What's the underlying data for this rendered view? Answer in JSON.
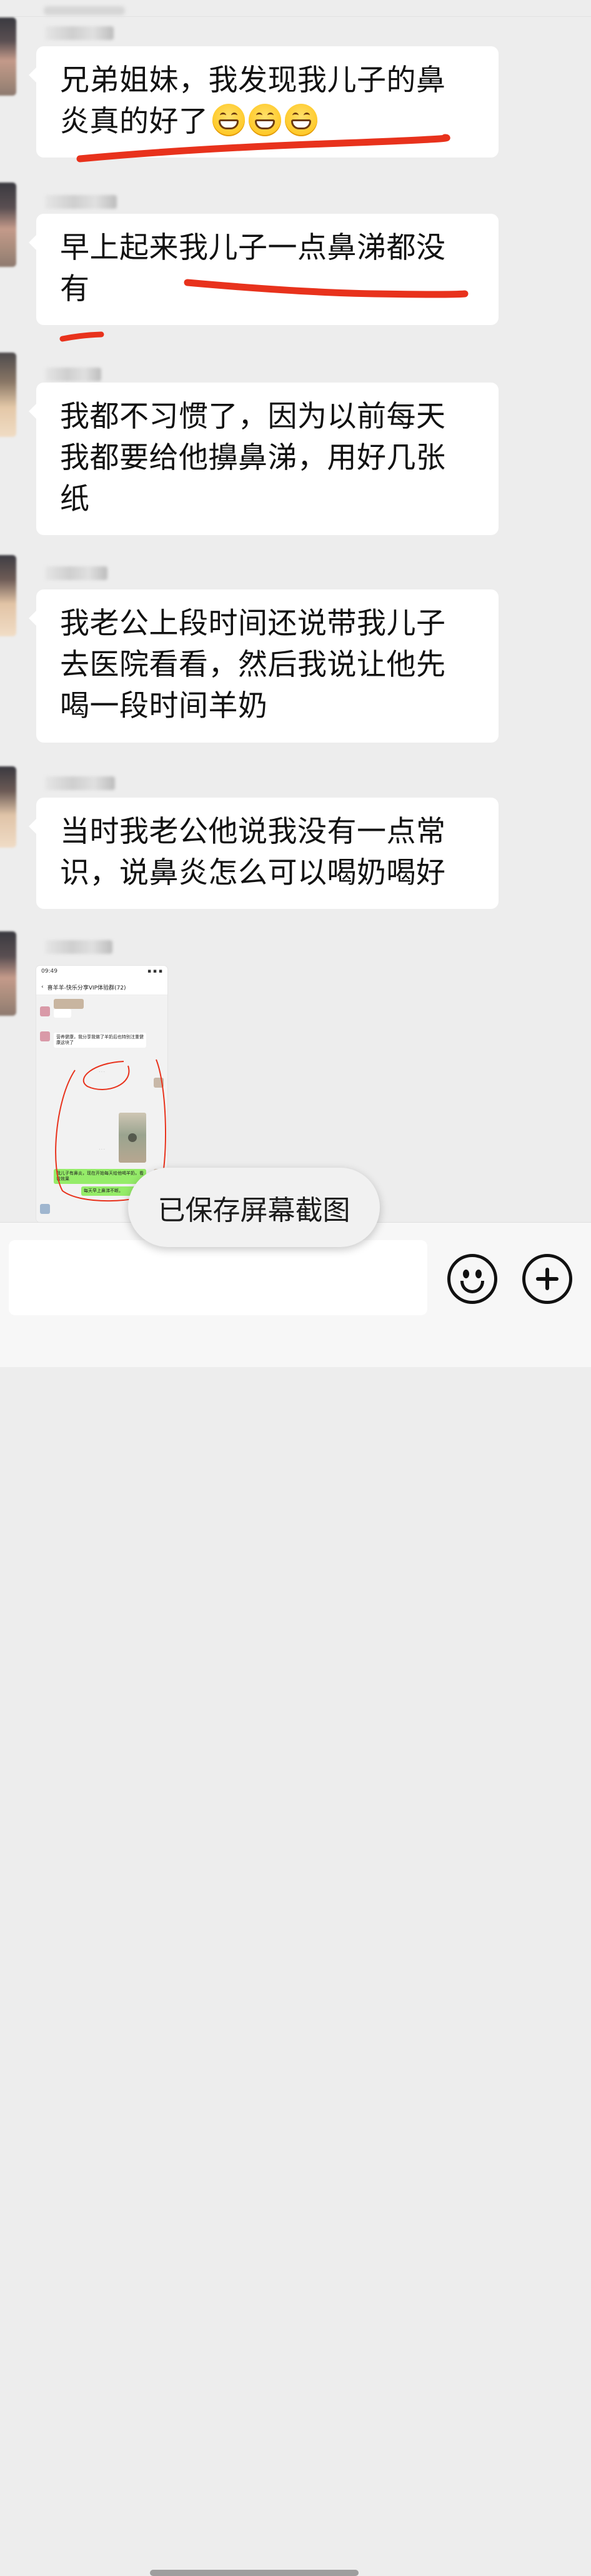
{
  "messages": [
    {
      "text": "兄弟姐妹，我发现我儿子的鼻炎真的好了",
      "emojis": [
        "grinning-face",
        "grinning-face",
        "grinning-face"
      ]
    },
    {
      "text": "早上起来我儿子一点鼻涕都没有"
    },
    {
      "text": "我都不习惯了，因为以前每天我都要给他擤鼻涕，用好几张纸"
    },
    {
      "text": "我老公上段时间还说带我儿子去医院看看，然后我说让他先喝一段时间羊奶"
    },
    {
      "text": "当时我老公他说我没有一点常识，说鼻炎怎么可以喝奶喝好"
    }
  ],
  "screenshot_thumbnail": {
    "status_time": "09:49",
    "group_title": "喜羊羊-快乐分享VIP体验群(72)",
    "bubbles": [
      "营养健康，我分享我做了羊奶后也特别注重健康这块了",
      "我儿子有鼻炎，现在开始每天给他喝羊奶，看看效果",
      "每天早上鼻涕不断。"
    ]
  },
  "toast": {
    "text": "已保存屏幕截图"
  },
  "input_bar": {
    "emoji_button": "smiley-icon",
    "more_button": "plus-icon"
  }
}
